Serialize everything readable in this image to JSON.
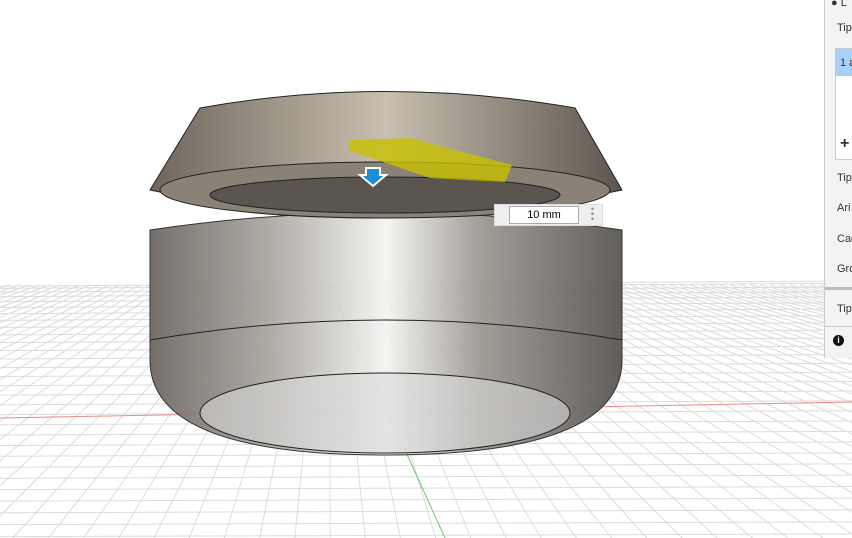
{
  "dimension_input": {
    "value": "10 mm"
  },
  "panel": {
    "header": "● L",
    "rows": [
      "Tip",
      "Tip",
      "Ari",
      "Cad",
      "Gro",
      "Tip"
    ],
    "list_item": "1 a",
    "add": "+",
    "info": "i"
  },
  "colors": {
    "accent": "#a8d0f8",
    "axis_x": "#e05050",
    "axis_y": "#40c040"
  }
}
